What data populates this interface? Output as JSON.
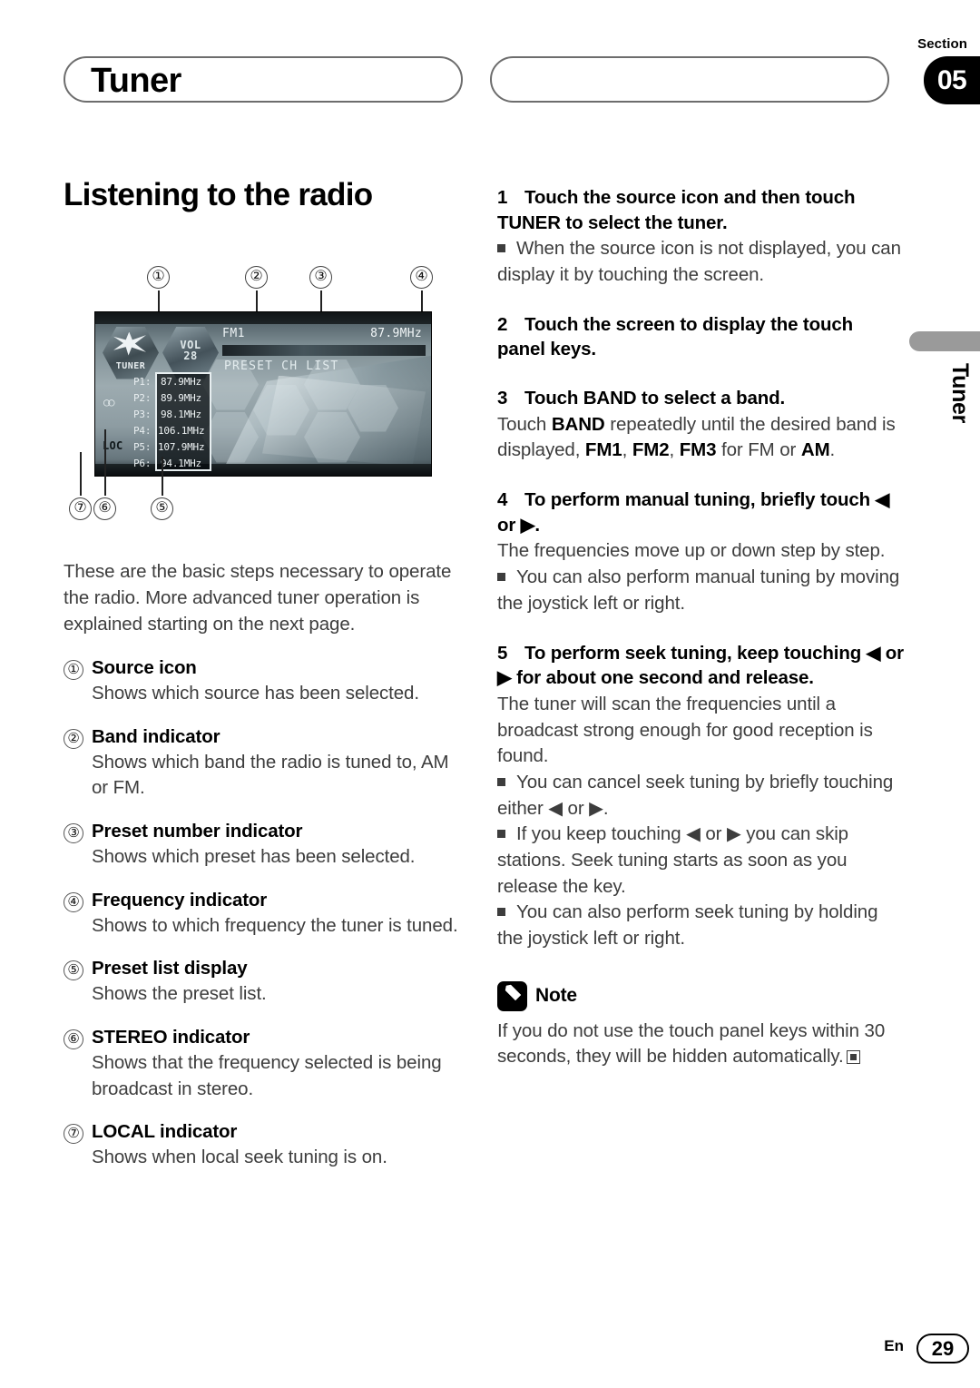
{
  "header": {
    "section_label": "Section",
    "section_number": "05",
    "title": "Tuner"
  },
  "side_tab": {
    "label": "Tuner"
  },
  "left": {
    "heading": "Listening to the radio",
    "intro": "These are the basic steps necessary to operate the radio. More advanced tuner operation is explained starting on the next page.",
    "items": [
      {
        "num": "①",
        "title": "Source icon",
        "desc": "Shows which source has been selected."
      },
      {
        "num": "②",
        "title": "Band indicator",
        "desc": "Shows which band the radio is tuned to, AM or FM."
      },
      {
        "num": "③",
        "title": "Preset number indicator",
        "desc": "Shows which preset has been selected."
      },
      {
        "num": "④",
        "title": "Frequency indicator",
        "desc": "Shows to which frequency the tuner is tuned."
      },
      {
        "num": "⑤",
        "title": "Preset list display",
        "desc": "Shows the preset list."
      },
      {
        "num": "⑥",
        "title": "STEREO indicator",
        "desc": "Shows that the frequency selected is being broadcast in stereo."
      },
      {
        "num": "⑦",
        "title": "LOCAL indicator",
        "desc": "Shows when local seek tuning is on."
      }
    ]
  },
  "figure": {
    "callouts_top": [
      "①",
      "②",
      "③",
      "④"
    ],
    "callouts_bottom": [
      "⑦",
      "⑥",
      "⑤"
    ],
    "device": {
      "source_label": "TUNER",
      "vol_line1": "VOL",
      "vol_line2": "28",
      "band": "FM1",
      "frequency": "87.9MHz",
      "preset_bar_label": "PRESET CH LIST",
      "stereo_indicator": "○○",
      "local_indicator": "LOC",
      "preset_labels": [
        "P1:",
        "P2:",
        "P3:",
        "P4:",
        "P5:",
        "P6:"
      ],
      "preset_values": [
        "87.9MHz",
        "89.9MHz",
        "98.1MHz",
        "106.1MHz",
        "107.9MHz",
        "94.1MHz"
      ]
    }
  },
  "right": {
    "step1_title_num": "1",
    "step1_title": "Touch the source icon and then touch TUNER to select the tuner.",
    "step1_bullet": "When the source icon is not displayed, you can display it by touching the screen.",
    "step2_title_num": "2",
    "step2_title": "Touch the screen to display the touch panel keys.",
    "step3_title_num": "3",
    "step3_title": "Touch BAND to select a band.",
    "step3_body_a": "Touch ",
    "step3_body_band": "BAND",
    "step3_body_b": " repeatedly until the desired band is displayed, ",
    "step3_fm1": "FM1",
    "step3_fm2": "FM2",
    "step3_fm3": "FM3",
    "step3_body_c": " for FM or ",
    "step3_am": "AM",
    "step3_body_d": ".",
    "step4_title_num": "4",
    "step4_title": "To perform manual tuning, briefly touch ◀ or ▶.",
    "step4_body": "The frequencies move up or down step by step.",
    "step4_bullet": "You can also perform manual tuning by moving the joystick left or right.",
    "step5_title_num": "5",
    "step5_title": "To perform seek tuning, keep touching ◀ or ▶ for about one second and release.",
    "step5_body": "The tuner will scan the frequencies until a broadcast strong enough for good reception is found.",
    "step5_bullet1": "You can cancel seek tuning by briefly touching either ◀ or ▶.",
    "step5_bullet2": "If you keep touching ◀ or ▶ you can skip stations. Seek tuning starts as soon as you release the key.",
    "step5_bullet3": "You can also perform seek tuning by holding the joystick left or right.",
    "note_title": "Note",
    "note_body": "If you do not use the touch panel keys within 30 seconds, they will be hidden automatically."
  },
  "footer": {
    "lang": "En",
    "page": "29"
  }
}
